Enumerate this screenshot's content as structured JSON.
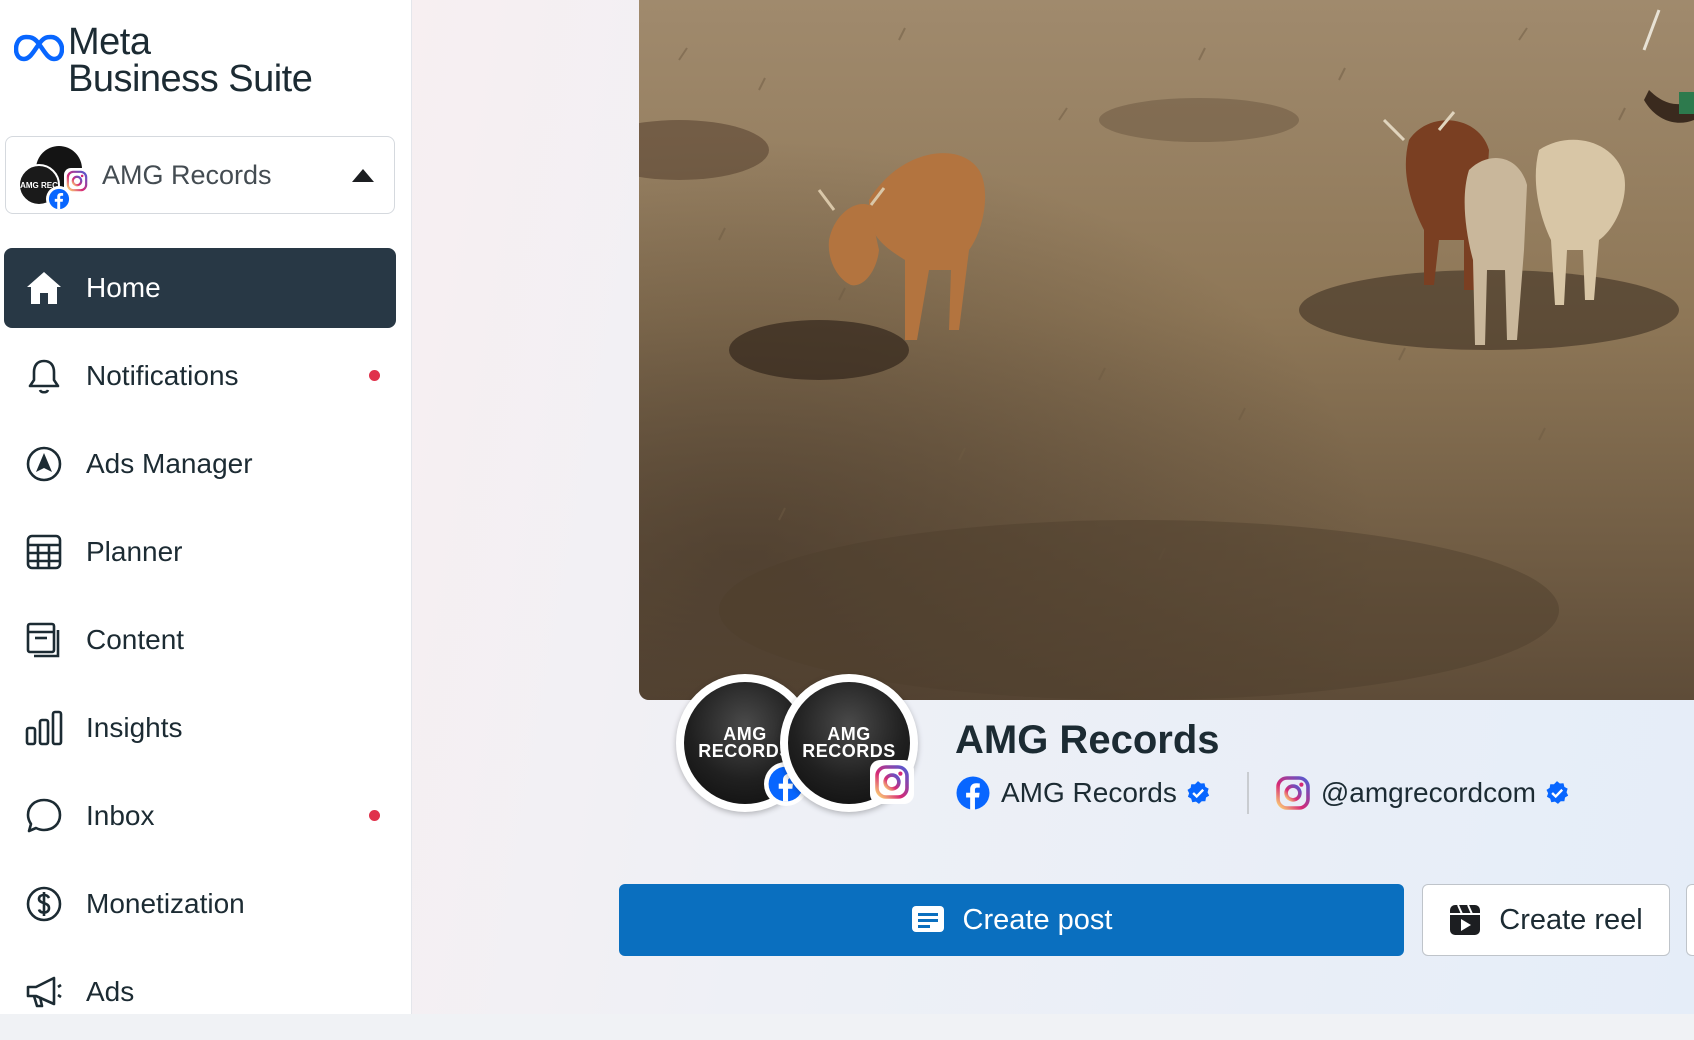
{
  "brand": {
    "line1": "Meta",
    "line2": "Business Suite",
    "color": "#0866ff"
  },
  "account_switcher": {
    "name": "AMG Records",
    "avatar_text": "AMG REC"
  },
  "nav": {
    "items": [
      {
        "label": "Home",
        "icon": "home-icon",
        "active": true
      },
      {
        "label": "Notifications",
        "icon": "bell-icon",
        "dot": true
      },
      {
        "label": "Ads Manager",
        "icon": "navigation-arrow-icon"
      },
      {
        "label": "Planner",
        "icon": "calendar-grid-icon"
      },
      {
        "label": "Content",
        "icon": "content-pages-icon"
      },
      {
        "label": "Insights",
        "icon": "bar-chart-icon"
      },
      {
        "label": "Inbox",
        "icon": "chat-bubble-icon",
        "dot": true
      },
      {
        "label": "Monetization",
        "icon": "dollar-circle-icon"
      },
      {
        "label": "Ads",
        "icon": "megaphone-icon"
      }
    ],
    "active_color": "#283845",
    "dot_color": "#e0314b"
  },
  "profile": {
    "page_name": "AMG Records",
    "avatar_text_line1": "AMG",
    "avatar_text_line2": "RECORDS",
    "facebook_name": "AMG Records",
    "instagram_handle": "@amgrecordcom",
    "verified": true
  },
  "actions": {
    "create_post": "Create post",
    "create_reel": "Create reel",
    "primary_color": "#0a6fbf"
  }
}
